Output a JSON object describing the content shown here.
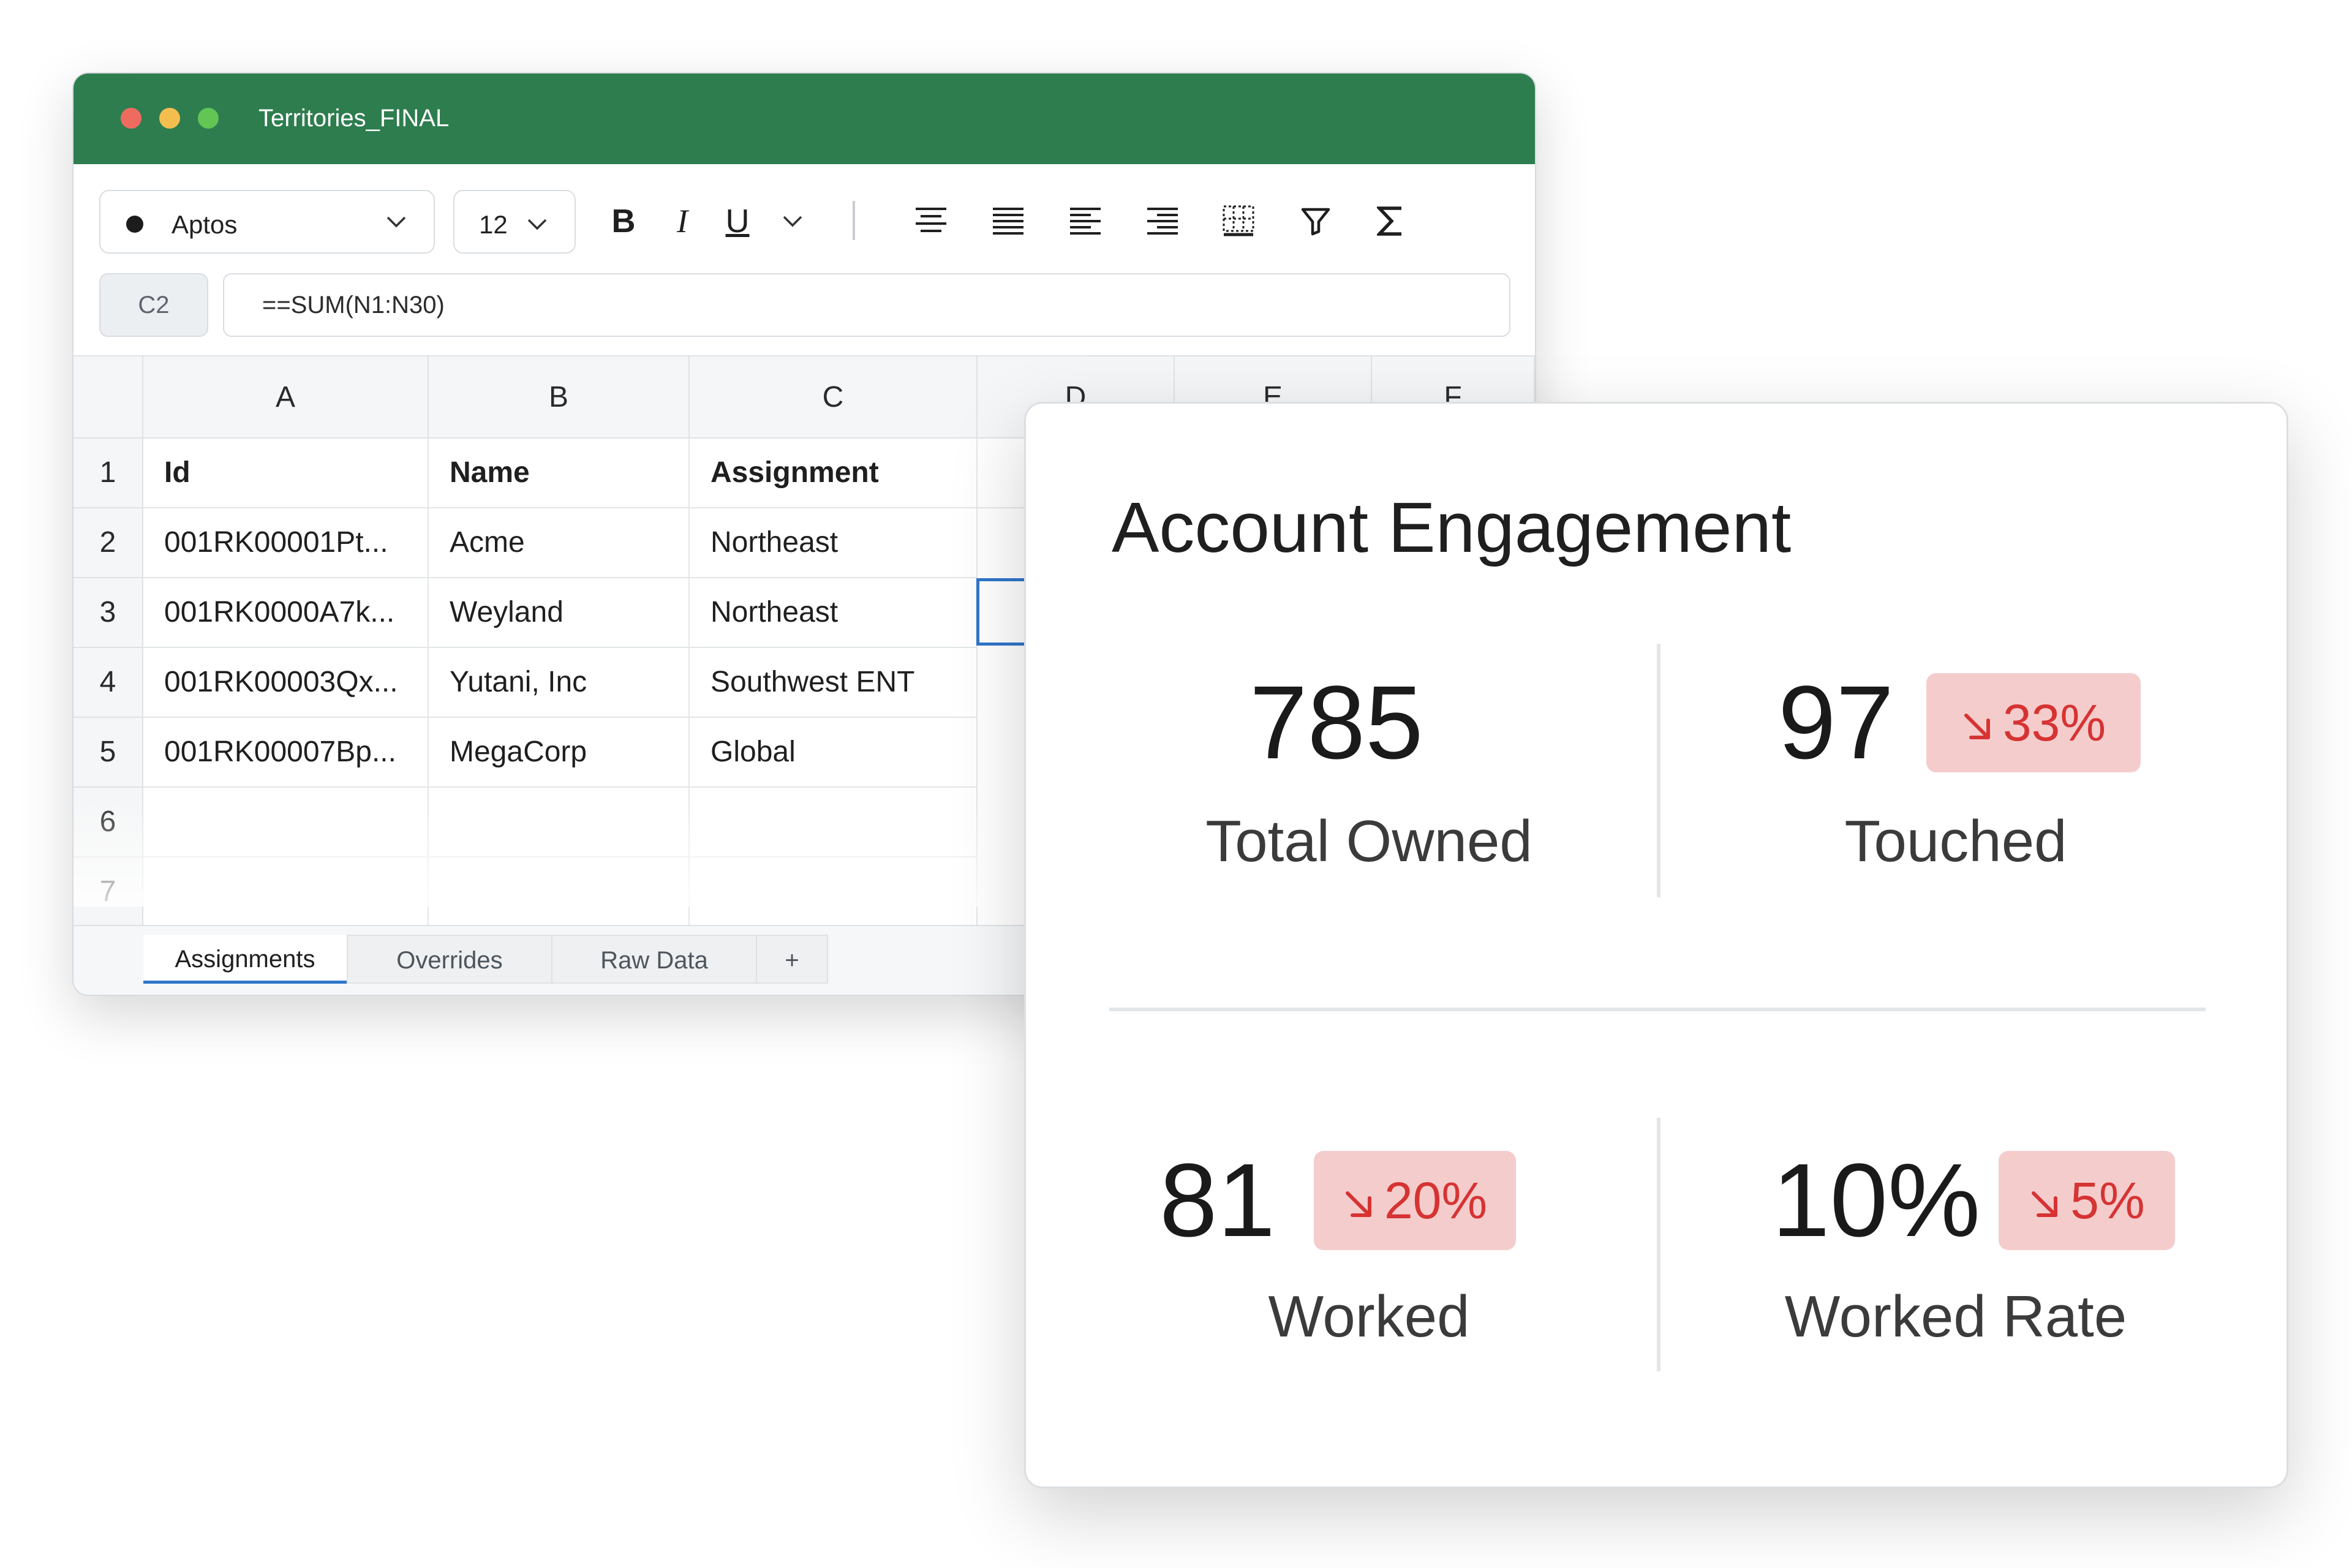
{
  "window": {
    "title": "Territories_FINAL",
    "font": "Aptos",
    "font_size": "12",
    "toolbar": {
      "bold": "B",
      "italic": "I",
      "underline": "U"
    },
    "name_box": "C2",
    "formula": "==SUM(N1:N30)"
  },
  "sheet": {
    "columns": [
      "A",
      "B",
      "C",
      "D",
      "E",
      "F"
    ],
    "rows": [
      "1",
      "2",
      "3",
      "4",
      "5",
      "6",
      "7"
    ],
    "header": [
      "Id",
      "Name",
      "Assignment"
    ],
    "data": [
      [
        "001RK00001Pt...",
        "Acme",
        "Northeast"
      ],
      [
        "001RK0000A7k...",
        "Weyland",
        "Northeast"
      ],
      [
        "001RK00003Qx...",
        "Yutani, Inc",
        "Southwest ENT"
      ],
      [
        "001RK00007Bp...",
        "MegaCorp",
        "Global"
      ]
    ],
    "tabs": [
      "Assignments",
      "Overrides",
      "Raw Data",
      "+"
    ],
    "active_tab": "Assignments"
  },
  "card": {
    "title": "Account Engagement",
    "metrics": [
      {
        "value": "785",
        "label": "Total Owned"
      },
      {
        "value": "97",
        "label": "Touched",
        "change": "33%"
      },
      {
        "value": "81",
        "label": "Worked",
        "change": "20%"
      },
      {
        "value": "10%",
        "label": "Worked Rate",
        "change": "5%"
      }
    ]
  },
  "colors": {
    "titlebar": "#2e7d4f",
    "badge_bg": "#f5cccc",
    "badge_text": "#d63333",
    "selection": "#2f76c9"
  }
}
